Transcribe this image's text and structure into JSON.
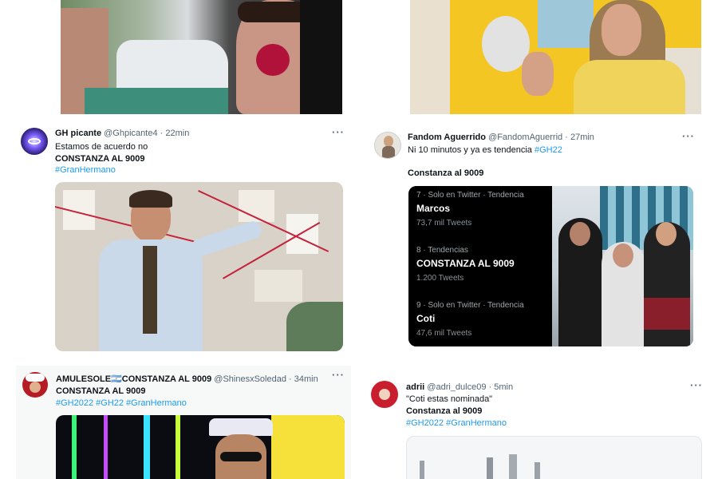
{
  "tweets": [
    {
      "name": "GH picante",
      "handle": "@Ghpicante4",
      "time": "22min",
      "lines": [
        "Estamos de acuerdo no",
        "CONSTANZA AL 9009"
      ],
      "hashtags": "#GranHermano"
    },
    {
      "name": "Fandom Aguerrido",
      "handle": "@FandomAguerrid",
      "time": "27min",
      "text": "Ni 10 minutos y ya es tendencia",
      "hashtag_inline": "#GH22",
      "line2": "Constanza al 9009"
    },
    {
      "name": "AMULESOLE🇦🇷CONSTANZA AL 9009",
      "handle": "@ShinesxSoledad",
      "time": "34min",
      "lines": [
        "CONSTANZA AL 9009"
      ],
      "hashtags": "#GH2022 #GH22 #GranHermano"
    },
    {
      "name": "adrii",
      "handle": "@adri_dulce09",
      "time": "5min",
      "lines": [
        "\"Coti estas nominada\"",
        "Constanza al 9009"
      ],
      "hashtags": "#GH2022 #GranHermano"
    }
  ],
  "separator": "·",
  "more_label": "···",
  "trends": [
    {
      "category": "7 · Solo en Twitter · Tendencia",
      "name": "Marcos",
      "count": "73,7 mil Tweets"
    },
    {
      "category": "8 · Tendencias",
      "name": "CONSTANZA AL 9009",
      "count": "1.200 Tweets"
    },
    {
      "category": "9 · Solo en Twitter · Tendencia",
      "name": "Coti",
      "count": "47,6 mil Tweets"
    }
  ],
  "icons": {
    "more": "more-horizontal-icon"
  }
}
